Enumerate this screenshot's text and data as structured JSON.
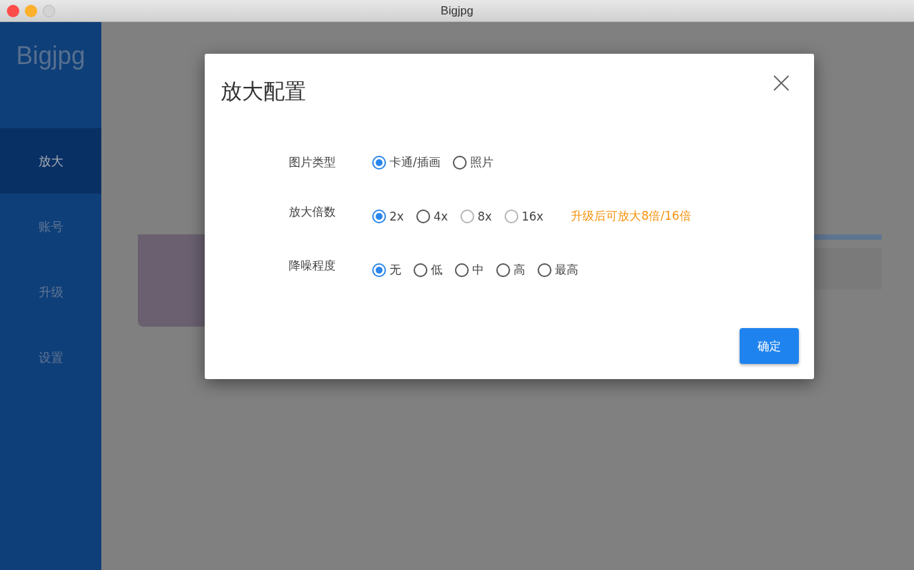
{
  "window": {
    "title": "Bigjpg"
  },
  "sidebar": {
    "logo": "Bigjpg",
    "items": [
      {
        "label": "放大",
        "selected": true
      },
      {
        "label": "账号",
        "selected": false
      },
      {
        "label": "升级",
        "selected": false
      },
      {
        "label": "设置",
        "selected": false
      }
    ]
  },
  "background": {
    "progress": {
      "level": 1
    }
  },
  "dialog": {
    "title": "放大配置",
    "groups": [
      {
        "label": "图片类型",
        "options": [
          {
            "label": "卡通/插画",
            "selected": true,
            "disabled": false
          },
          {
            "label": "照片",
            "selected": false,
            "disabled": false
          }
        ]
      },
      {
        "label": "放大倍数",
        "options": [
          {
            "label": "2x",
            "selected": true,
            "disabled": false
          },
          {
            "label": "4x",
            "selected": false,
            "disabled": false
          },
          {
            "label": "8x",
            "selected": false,
            "disabled": true
          },
          {
            "label": "16x",
            "selected": false,
            "disabled": true
          }
        ],
        "note": "升级后可放大8倍/16倍"
      },
      {
        "label": "降噪程度",
        "options": [
          {
            "label": "无",
            "selected": true,
            "disabled": false
          },
          {
            "label": "低",
            "selected": false,
            "disabled": false
          },
          {
            "label": "中",
            "selected": false,
            "disabled": false
          },
          {
            "label": "高",
            "selected": false,
            "disabled": false
          },
          {
            "label": "最高",
            "selected": false,
            "disabled": false
          }
        ]
      }
    ],
    "confirm": "确定"
  }
}
